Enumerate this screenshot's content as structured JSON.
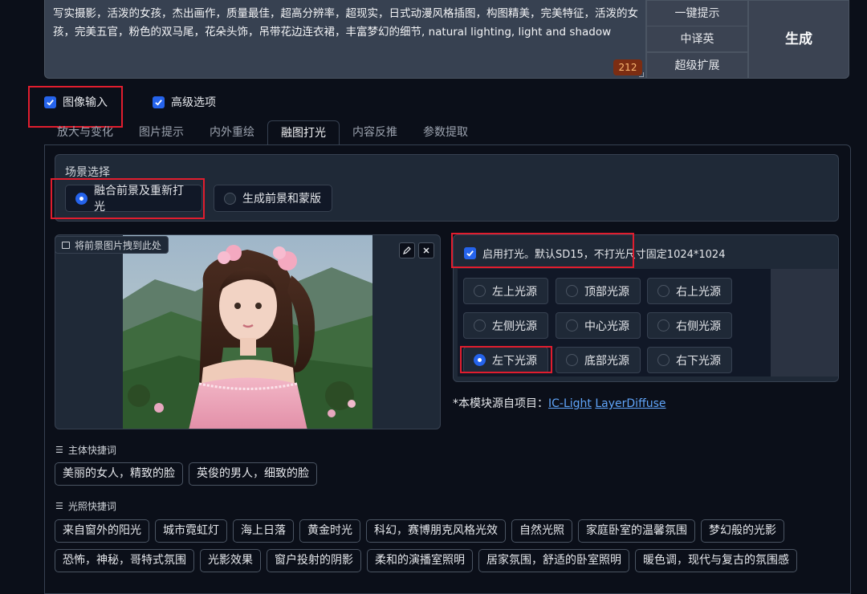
{
  "prompt": {
    "text": "写实摄影，活泼的女孩，杰出画作，质量最佳，超高分辨率，超现实，日式动漫风格插图，构图精美，完美特征，活泼的女孩，完美五官，粉色的双马尾，花朵头饰，吊带花边连衣裙，丰富梦幻的细节, natural lighting, light and shadow",
    "token_count": "212"
  },
  "side_buttons": [
    "一键提示",
    "中译英",
    "超级扩展"
  ],
  "generate_label": "生成",
  "options": {
    "image_input": "图像输入",
    "advanced": "高级选项"
  },
  "tabs": [
    "放大与变化",
    "图片提示",
    "内外重绘",
    "融图打光",
    "内容反推",
    "参数提取"
  ],
  "scene": {
    "title": "场景选择",
    "choices": [
      "融合前景及重新打光",
      "生成前景和蒙版"
    ]
  },
  "image_drop_label": "将前景图片拽到此处",
  "lighting": {
    "enable_label": "启用打光。默认SD15，不打光尺寸固定1024*1024",
    "sources": [
      [
        "左上光源",
        "顶部光源",
        "右上光源"
      ],
      [
        "左侧光源",
        "中心光源",
        "右侧光源"
      ],
      [
        "左下光源",
        "底部光源",
        "右下光源"
      ]
    ],
    "selected": "左下光源"
  },
  "credit": {
    "prefix": "*本模块源自项目：",
    "link1": "IC-Light",
    "link2": "LayerDiffuse"
  },
  "subject_shortcuts": {
    "title": "主体快捷词",
    "items": [
      "美丽的女人，精致的脸",
      "英俊的男人，细致的脸"
    ]
  },
  "lighting_shortcuts": {
    "title": "光照快捷词",
    "row1": [
      "来自窗外的阳光",
      "城市霓虹灯",
      "海上日落",
      "黄金时光",
      "科幻，赛博朋克风格光效",
      "自然光照",
      "家庭卧室的温馨氛围",
      "梦幻般的光影"
    ],
    "row2": [
      "恐怖，神秘，哥特式氛围",
      "光影效果",
      "窗户投射的阴影",
      "柔和的演播室照明",
      "居家氛围，舒适的卧室照明",
      "暖色调，现代与复古的氛围感"
    ]
  },
  "colors": {
    "accent": "#2563eb",
    "highlight_border": "#e11d2e",
    "background": "#0b0f19"
  }
}
